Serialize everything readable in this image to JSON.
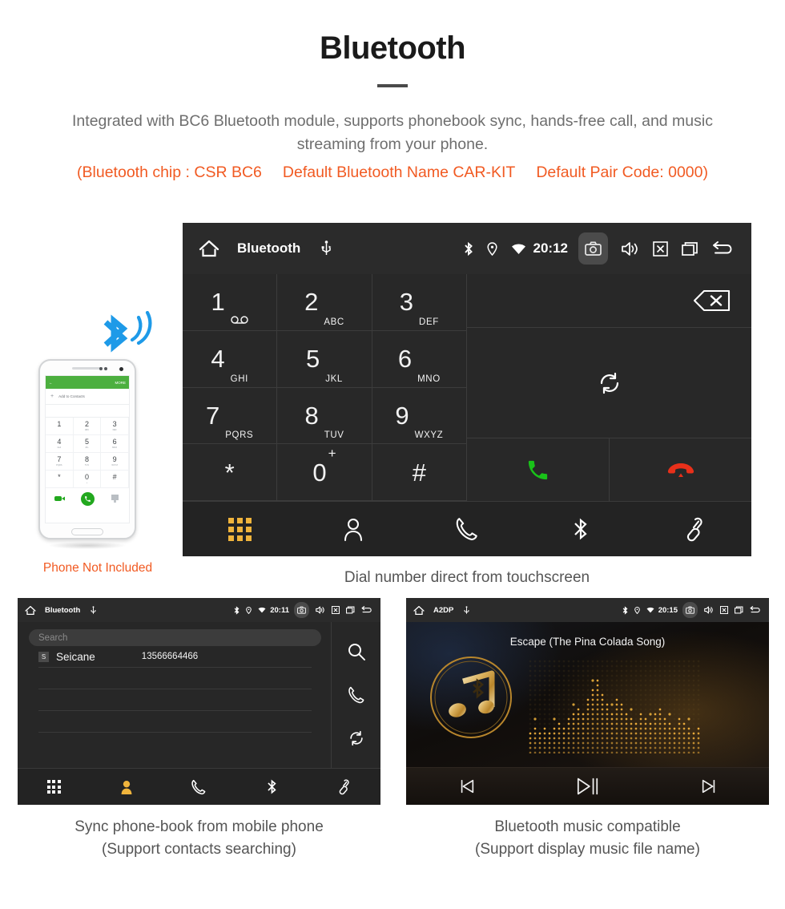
{
  "header": {
    "title": "Bluetooth",
    "description": "Integrated with BC6 Bluetooth module, supports phonebook sync, hands-free call, and music streaming from your phone.",
    "spec_chip": "(Bluetooth chip : CSR BC6",
    "spec_name": "Default Bluetooth Name CAR-KIT",
    "spec_pair": "Default Pair Code: 0000)",
    "accent_color": "#f15a22",
    "body_color": "#6e6e6e"
  },
  "dialer": {
    "statusbar": {
      "title": "Bluetooth",
      "time": "20:12",
      "icons": [
        "home-icon",
        "usb-icon",
        "bluetooth-icon",
        "location-icon",
        "wifi-icon",
        "camera-icon",
        "volume-icon",
        "close-icon",
        "recents-icon",
        "back-icon"
      ]
    },
    "keys": [
      {
        "digit": "1",
        "sub": "",
        "glyph": "voicemail"
      },
      {
        "digit": "2",
        "sub": "ABC",
        "glyph": ""
      },
      {
        "digit": "3",
        "sub": "DEF",
        "glyph": ""
      },
      {
        "digit": "4",
        "sub": "GHI",
        "glyph": ""
      },
      {
        "digit": "5",
        "sub": "JKL",
        "glyph": ""
      },
      {
        "digit": "6",
        "sub": "MNO",
        "glyph": ""
      },
      {
        "digit": "7",
        "sub": "PQRS",
        "glyph": ""
      },
      {
        "digit": "8",
        "sub": "TUV",
        "glyph": ""
      },
      {
        "digit": "9",
        "sub": "WXYZ",
        "glyph": ""
      },
      {
        "digit": "*",
        "sub": "",
        "glyph": ""
      },
      {
        "digit": "0",
        "sup": "+",
        "sub": "",
        "glyph": ""
      },
      {
        "digit": "#",
        "sub": "",
        "glyph": ""
      }
    ],
    "number_input": "",
    "actions": {
      "backspace": "backspace-icon",
      "sync": "sync-icon",
      "call": "call-icon",
      "hangup": "hangup-icon",
      "call_color": "#19c219",
      "hangup_color": "#e8301a"
    },
    "tabs": [
      {
        "name": "dialpad",
        "active": true
      },
      {
        "name": "contacts",
        "active": false
      },
      {
        "name": "call-history",
        "active": false
      },
      {
        "name": "bluetooth",
        "active": false
      },
      {
        "name": "link",
        "active": false
      }
    ],
    "active_color": "#f0b43c",
    "caption": "Dial number direct from touchscreen"
  },
  "phone_mock": {
    "header_more": "MORE",
    "add_contacts": "Add to Contacts",
    "keys": [
      {
        "d": "1",
        "s": ""
      },
      {
        "d": "2",
        "s": "ABC"
      },
      {
        "d": "3",
        "s": "DEF"
      },
      {
        "d": "4",
        "s": "GHI"
      },
      {
        "d": "5",
        "s": "JKL"
      },
      {
        "d": "6",
        "s": "MNO"
      },
      {
        "d": "7",
        "s": "PQRS"
      },
      {
        "d": "8",
        "s": "TUV"
      },
      {
        "d": "9",
        "s": "WXYZ"
      },
      {
        "d": "*",
        "s": ""
      },
      {
        "d": "0",
        "s": "+"
      },
      {
        "d": "#",
        "s": ""
      }
    ],
    "not_included_label": "Phone Not Included"
  },
  "phonebook": {
    "statusbar": {
      "title": "Bluetooth",
      "time": "20:11"
    },
    "search_placeholder": "Search",
    "contacts": [
      {
        "initial": "S",
        "name": "Seicane",
        "number": "13566664466"
      }
    ],
    "side_actions": [
      "search-icon",
      "call-icon",
      "sync-icon"
    ],
    "tabs": [
      {
        "name": "dialpad",
        "active": false
      },
      {
        "name": "contacts",
        "active": true
      },
      {
        "name": "call-history",
        "active": false
      },
      {
        "name": "bluetooth",
        "active": false
      },
      {
        "name": "link",
        "active": false
      }
    ],
    "caption_line1": "Sync phone-book from mobile phone",
    "caption_line2": "(Support contacts searching)"
  },
  "music": {
    "statusbar": {
      "title": "A2DP",
      "time": "20:15"
    },
    "song_title": "Escape (The Pina Colada Song)",
    "controls": [
      "previous-icon",
      "play-pause-icon",
      "next-icon"
    ],
    "gold_color": "#c9962f",
    "caption_line1": "Bluetooth music compatible",
    "caption_line2": "(Support display music file name)"
  }
}
